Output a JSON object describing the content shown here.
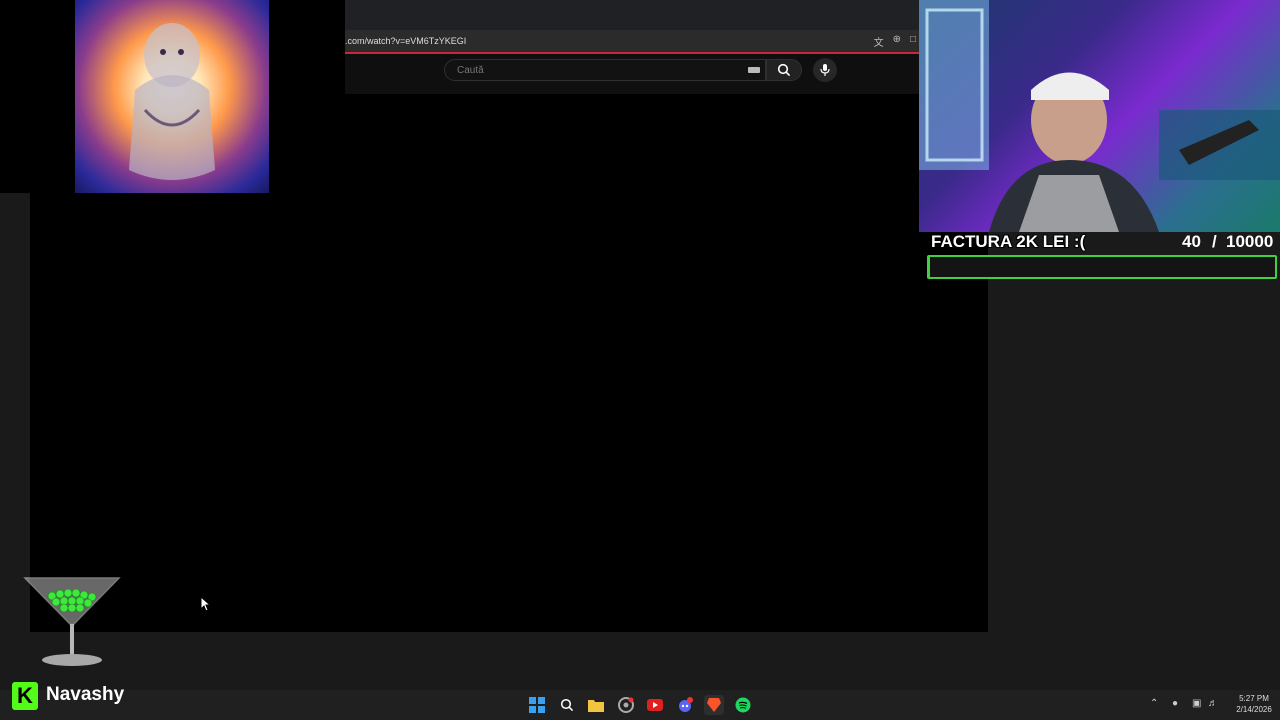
{
  "browser": {
    "url": ".com/watch?v=eVM6TzYKEGI",
    "tool_icons": [
      "translate-icon",
      "zoom-icon",
      "window-icon"
    ]
  },
  "youtube": {
    "search_placeholder": "Caută"
  },
  "stream_goal": {
    "label": "FACTURA 2K LEI :(",
    "current": "40",
    "separator": "/",
    "target": "10000",
    "progress_fraction": 0.004,
    "bar_color": "#3fd13f"
  },
  "branding": {
    "platform_letter": "K",
    "channel_name": "Navashy",
    "brand_color": "#53fc18"
  },
  "taskbar": {
    "apps": [
      "windows-start-icon",
      "search-icon",
      "file-explorer-icon",
      "chrome-icon",
      "youtube-icon",
      "discord-icon",
      "brave-icon",
      "spotify-icon"
    ],
    "time": "5:27 PM",
    "date": "2/14/2026"
  }
}
